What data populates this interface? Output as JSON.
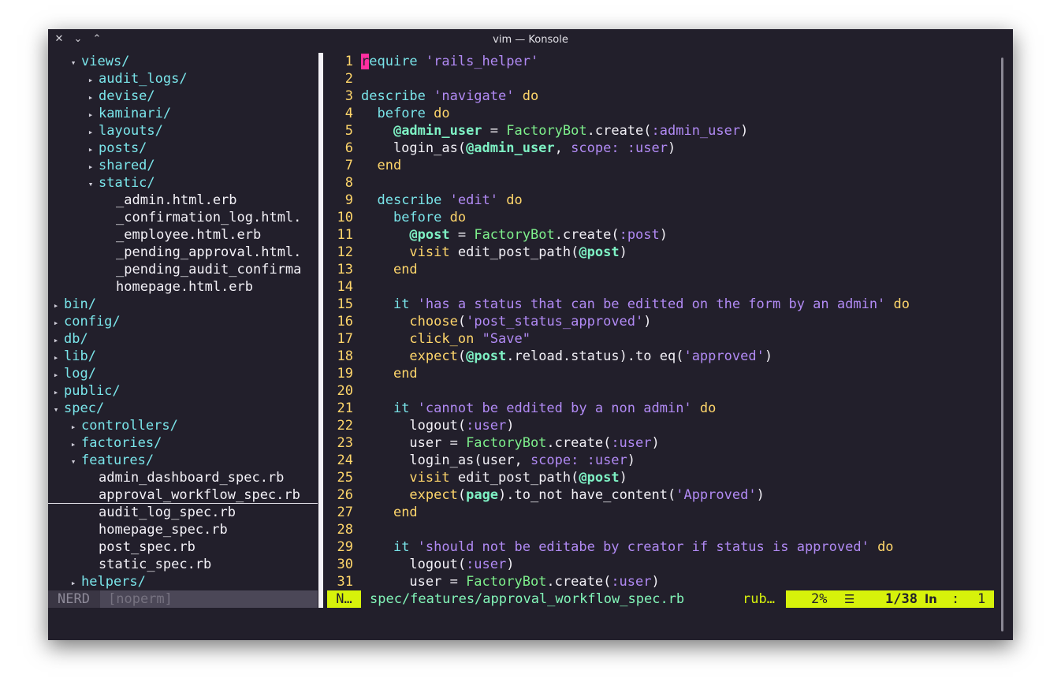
{
  "window": {
    "title": "vim — Konsole"
  },
  "tree": {
    "lines": [
      {
        "arrow": "▾",
        "name": "views/",
        "type": "dir",
        "indent": 1
      },
      {
        "arrow": "▸",
        "name": "audit_logs/",
        "type": "dir",
        "indent": 2
      },
      {
        "arrow": "▸",
        "name": "devise/",
        "type": "dir",
        "indent": 2
      },
      {
        "arrow": "▸",
        "name": "kaminari/",
        "type": "dir",
        "indent": 2
      },
      {
        "arrow": "▸",
        "name": "layouts/",
        "type": "dir",
        "indent": 2
      },
      {
        "arrow": "▸",
        "name": "posts/",
        "type": "dir",
        "indent": 2
      },
      {
        "arrow": "▸",
        "name": "shared/",
        "type": "dir",
        "indent": 2
      },
      {
        "arrow": "▾",
        "name": "static/",
        "type": "dir",
        "indent": 2
      },
      {
        "arrow": "",
        "name": "_admin.html.erb",
        "type": "file",
        "indent": 3
      },
      {
        "arrow": "",
        "name": "_confirmation_log.html.",
        "type": "file",
        "indent": 3
      },
      {
        "arrow": "",
        "name": "_employee.html.erb",
        "type": "file",
        "indent": 3
      },
      {
        "arrow": "",
        "name": "_pending_approval.html.",
        "type": "file",
        "indent": 3
      },
      {
        "arrow": "",
        "name": "_pending_audit_confirma",
        "type": "file",
        "indent": 3
      },
      {
        "arrow": "",
        "name": "homepage.html.erb",
        "type": "file",
        "indent": 3
      },
      {
        "arrow": "▸",
        "name": "bin/",
        "type": "dir",
        "indent": 0
      },
      {
        "arrow": "▸",
        "name": "config/",
        "type": "dir",
        "indent": 0
      },
      {
        "arrow": "▸",
        "name": "db/",
        "type": "dir",
        "indent": 0
      },
      {
        "arrow": "▸",
        "name": "lib/",
        "type": "dir",
        "indent": 0
      },
      {
        "arrow": "▸",
        "name": "log/",
        "type": "dir",
        "indent": 0
      },
      {
        "arrow": "▸",
        "name": "public/",
        "type": "dir",
        "indent": 0
      },
      {
        "arrow": "▾",
        "name": "spec/",
        "type": "dir",
        "indent": 0
      },
      {
        "arrow": "▸",
        "name": "controllers/",
        "type": "dir",
        "indent": 1
      },
      {
        "arrow": "▸",
        "name": "factories/",
        "type": "dir",
        "indent": 1
      },
      {
        "arrow": "▾",
        "name": "features/",
        "type": "dir",
        "indent": 1
      },
      {
        "arrow": "",
        "name": "admin_dashboard_spec.rb",
        "type": "file",
        "indent": 2
      },
      {
        "arrow": "",
        "name": "approval_workflow_spec.rb",
        "type": "file",
        "indent": 2,
        "cursor": true
      },
      {
        "arrow": "",
        "name": "audit_log_spec.rb",
        "type": "file",
        "indent": 2
      },
      {
        "arrow": "",
        "name": "homepage_spec.rb",
        "type": "file",
        "indent": 2
      },
      {
        "arrow": "",
        "name": "post_spec.rb",
        "type": "file",
        "indent": 2
      },
      {
        "arrow": "",
        "name": "static_spec.rb",
        "type": "file",
        "indent": 2
      },
      {
        "arrow": "▸",
        "name": "helpers/",
        "type": "dir",
        "indent": 1
      }
    ],
    "status_left": "NERD",
    "status_right": "[noperm]"
  },
  "code": {
    "lines": [
      [
        [
          "cur",
          "r"
        ],
        [
          "kw-c",
          "equire "
        ],
        [
          "str",
          "'rails_helper'"
        ]
      ],
      [],
      [
        [
          "kw-c",
          "describe "
        ],
        [
          "str",
          "'navigate'"
        ],
        [
          "kw-y",
          " do"
        ]
      ],
      [
        [
          "",
          "  "
        ],
        [
          "kw-c",
          "before"
        ],
        [
          "kw-y",
          " do"
        ]
      ],
      [
        [
          "",
          "    "
        ],
        [
          "ivar",
          "@admin_user"
        ],
        [
          "",
          " = "
        ],
        [
          "const",
          "FactoryBot"
        ],
        [
          "",
          ".create("
        ],
        [
          "sym",
          ":admin_user"
        ],
        [
          "",
          ")"
        ]
      ],
      [
        [
          "",
          "    login_as("
        ],
        [
          "ivar",
          "@admin_user"
        ],
        [
          "",
          ", "
        ],
        [
          "label",
          "scope:"
        ],
        [
          "sym",
          " :user"
        ],
        [
          "",
          ")"
        ]
      ],
      [
        [
          "",
          "  "
        ],
        [
          "kw-y",
          "end"
        ]
      ],
      [],
      [
        [
          "",
          "  "
        ],
        [
          "kw-c",
          "describe "
        ],
        [
          "str",
          "'edit'"
        ],
        [
          "kw-y",
          " do"
        ]
      ],
      [
        [
          "",
          "    "
        ],
        [
          "kw-c",
          "before"
        ],
        [
          "kw-y",
          " do"
        ]
      ],
      [
        [
          "",
          "      "
        ],
        [
          "ivar",
          "@post"
        ],
        [
          "",
          " = "
        ],
        [
          "const",
          "FactoryBot"
        ],
        [
          "",
          ".create("
        ],
        [
          "sym",
          ":post"
        ],
        [
          "",
          ")"
        ]
      ],
      [
        [
          "",
          "      "
        ],
        [
          "kw-y",
          "visit"
        ],
        [
          "",
          " edit_post_path("
        ],
        [
          "ivar",
          "@post"
        ],
        [
          "",
          ")"
        ]
      ],
      [
        [
          "",
          "    "
        ],
        [
          "kw-y",
          "end"
        ]
      ],
      [],
      [
        [
          "",
          "    "
        ],
        [
          "kw-c",
          "it "
        ],
        [
          "str",
          "'has a status that can be editted on the form by an admin'"
        ],
        [
          "kw-y",
          " do"
        ]
      ],
      [
        [
          "",
          "      "
        ],
        [
          "kw-y",
          "choose"
        ],
        [
          "",
          "("
        ],
        [
          "str",
          "'post_status_approved'"
        ],
        [
          "",
          ")"
        ]
      ],
      [
        [
          "",
          "      "
        ],
        [
          "kw-y",
          "click_on"
        ],
        [
          "",
          " "
        ],
        [
          "str",
          "\"Save\""
        ]
      ],
      [
        [
          "",
          "      "
        ],
        [
          "kw-y",
          "expect"
        ],
        [
          "",
          "("
        ],
        [
          "ivar",
          "@post"
        ],
        [
          "",
          ".reload.status).to eq("
        ],
        [
          "str",
          "'approved'"
        ],
        [
          "",
          ")"
        ]
      ],
      [
        [
          "",
          "    "
        ],
        [
          "kw-y",
          "end"
        ]
      ],
      [],
      [
        [
          "",
          "    "
        ],
        [
          "kw-c",
          "it "
        ],
        [
          "str",
          "'cannot be eddited by a non admin'"
        ],
        [
          "kw-y",
          " do"
        ]
      ],
      [
        [
          "",
          "      logout("
        ],
        [
          "sym",
          ":user"
        ],
        [
          "",
          ")"
        ]
      ],
      [
        [
          "",
          "      user = "
        ],
        [
          "const",
          "FactoryBot"
        ],
        [
          "",
          ".create("
        ],
        [
          "sym",
          ":user"
        ],
        [
          "",
          ")"
        ]
      ],
      [
        [
          "",
          "      login_as(user, "
        ],
        [
          "label",
          "scope:"
        ],
        [
          "sym",
          " :user"
        ],
        [
          "",
          ")"
        ]
      ],
      [
        [
          "",
          "      "
        ],
        [
          "kw-y",
          "visit"
        ],
        [
          "",
          " edit_post_path("
        ],
        [
          "ivar",
          "@post"
        ],
        [
          "",
          ")"
        ]
      ],
      [
        [
          "",
          "      "
        ],
        [
          "kw-y",
          "expect"
        ],
        [
          "",
          "("
        ],
        [
          "ivar",
          "page"
        ],
        [
          "",
          ").to_not have_content("
        ],
        [
          "str",
          "'Approved'"
        ],
        [
          "",
          ")"
        ]
      ],
      [
        [
          "",
          "    "
        ],
        [
          "kw-y",
          "end"
        ]
      ],
      [],
      [
        [
          "",
          "    "
        ],
        [
          "kw-c",
          "it "
        ],
        [
          "str",
          "'should not be editabe by creator if status is approved'"
        ],
        [
          "kw-y",
          " do"
        ]
      ],
      [
        [
          "",
          "      logout("
        ],
        [
          "sym",
          ":user"
        ],
        [
          "",
          ")"
        ]
      ],
      [
        [
          "",
          "      user = "
        ],
        [
          "const",
          "FactoryBot"
        ],
        [
          "",
          ".create("
        ],
        [
          "sym",
          ":user"
        ],
        [
          "",
          ")"
        ]
      ]
    ]
  },
  "statusline": {
    "mode": "N…",
    "file": "spec/features/approval_workflow_spec.rb",
    "filetype": "rub…",
    "percent": "2%",
    "menu_icon": "☰",
    "position": "1/38",
    "ln_icon": "ln",
    "colon": ":",
    "column": "1"
  },
  "icons": {
    "close": "✕",
    "minimize": "⌄",
    "maximize": "⌃"
  },
  "colors": {
    "background": "#221f2b",
    "accent": "#d7f20b",
    "cursor": "#ff2ea0"
  }
}
